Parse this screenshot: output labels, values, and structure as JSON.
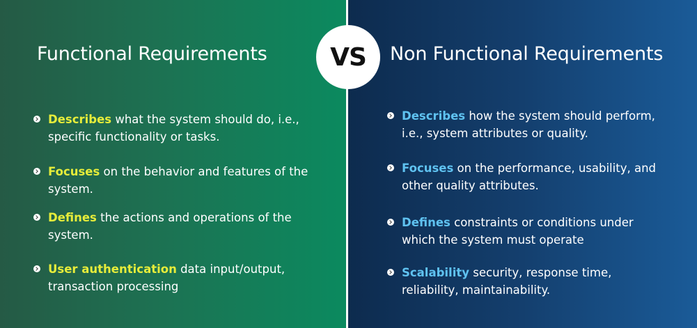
{
  "colors": {
    "left_accent": "#e6ec3a",
    "right_accent": "#5fc2f0",
    "left_background": "#1d7152",
    "right_background": "#143f6e",
    "text": "#ffffff"
  },
  "vs_label": "VS",
  "left": {
    "title": "Functional Requirements",
    "items": [
      {
        "keyword": "Describes",
        "text": " what the system should do, i.e., specific functionality or tasks."
      },
      {
        "keyword": "Focuses",
        "text": " on the behavior and features of the system."
      },
      {
        "keyword": "Defines",
        "text": " the actions and operations of the system."
      },
      {
        "keyword": "User authentication",
        "text": " data input/output, transaction processing"
      }
    ]
  },
  "right": {
    "title": "Non Functional Requirements",
    "items": [
      {
        "keyword": "Describes",
        "text": " how the system should perform, i.e., system attributes or quality."
      },
      {
        "keyword": "Focuses",
        "text": " on the performance, usability, and other quality attributes."
      },
      {
        "keyword": "Defines",
        "text": " constraints or conditions under which the system must operate"
      },
      {
        "keyword": "Scalability",
        "text": " security, response time, reliability, maintainability."
      }
    ]
  }
}
